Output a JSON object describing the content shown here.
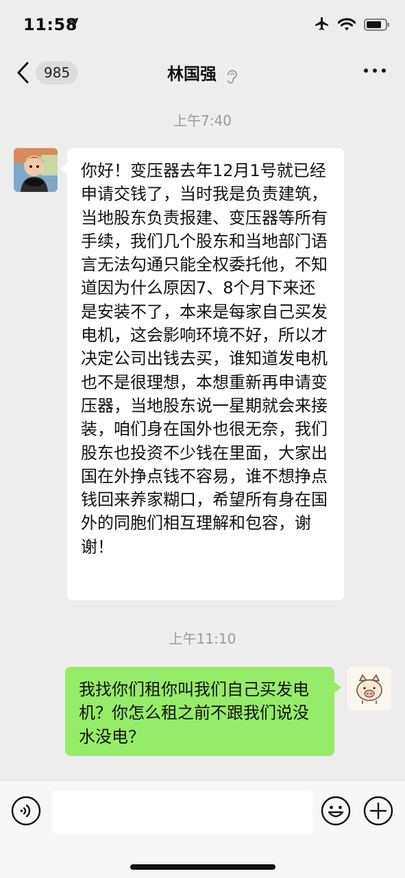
{
  "status_bar": {
    "time": "11:58",
    "icons": [
      "location-arrow-icon",
      "airplane-icon",
      "wifi-icon",
      "battery-icon"
    ]
  },
  "nav": {
    "unread_count": "985",
    "title": "林国强",
    "icons": [
      "back-chevron-icon",
      "ear-icon",
      "more-dots-icon"
    ]
  },
  "messages": [
    {
      "timestamp": "上午7:40"
    },
    {
      "side": "left",
      "text": "你好！变压器去年12月1号就已经申请交钱了，当时我是负责建筑，当地股东负责报建、变压器等所有手续，我们几个股东和当地部门语言无法勾通只能全权委托他，不知道因为什么原因7、8个月下来还是安装不了，本来是每家自己买发电机，这会影响环境不好，所以才决定公司出钱去买，谁知道发电机也不是很理想，本想重新再申请变压器，当地股东说一星期就会来接装，咱们身在国外也很无奈，我们股东也投资不少钱在里面，大家出国在外挣点钱不容易，谁不想挣点钱回来养家糊口，希望所有身在国外的同胞们相互理解和包容，谢谢！"
    },
    {
      "timestamp": "上午11:10"
    },
    {
      "side": "right",
      "text": "我找你们租你叫我们自己买发电机？你怎么租之前不跟我们说没水没电？"
    }
  ],
  "input_bar": {
    "icons": [
      "voice-icon",
      "emoji-icon",
      "plus-icon"
    ]
  },
  "colors": {
    "background": "#ededed",
    "outgoing_bubble": "#95ec69",
    "incoming_bubble": "#ffffff"
  }
}
